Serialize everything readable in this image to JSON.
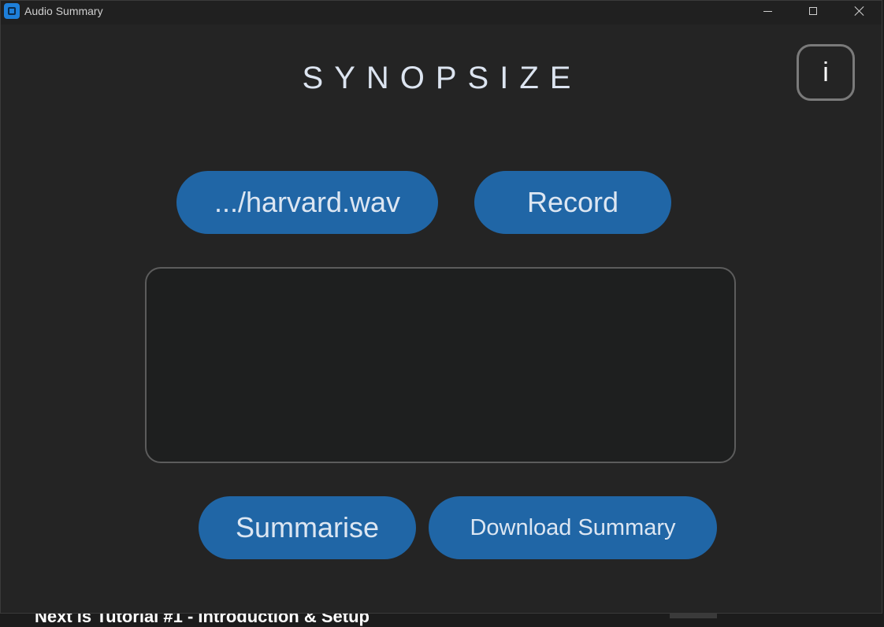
{
  "window": {
    "title": "Audio Summary",
    "controls": [
      "minimize",
      "maximize",
      "close"
    ]
  },
  "app": {
    "title": "SYNOPSIZE",
    "info_label": "i"
  },
  "buttons": {
    "file_label": ".../harvard.wav",
    "record_label": "Record",
    "summarise_label": "Summarise",
    "download_label": "Download Summary"
  },
  "output": {
    "value": ""
  },
  "background": {
    "partial_text": "Next is Tutorial #1 - Introduction & Setup"
  },
  "colors": {
    "accent": "#2066a6",
    "window_bg": "#242424",
    "textbox_bg": "#1e1f1f",
    "title_text": "#dce4f0"
  }
}
